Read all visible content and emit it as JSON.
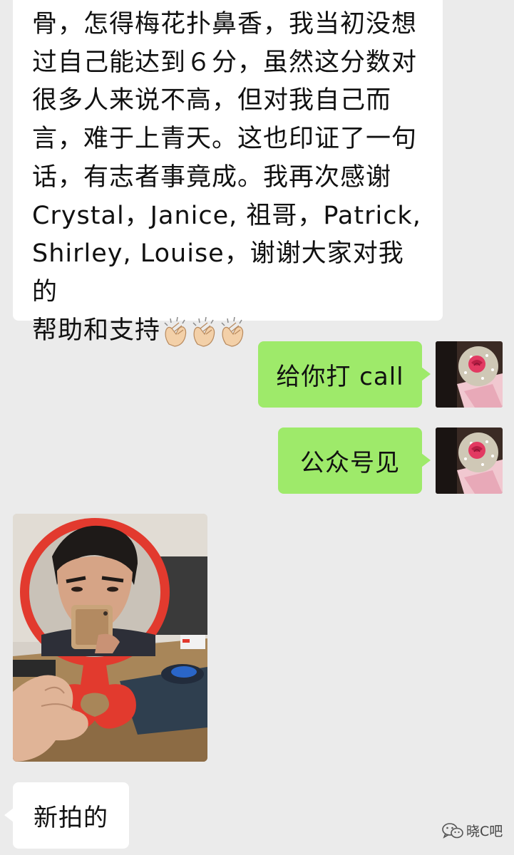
{
  "chat": {
    "messages": [
      {
        "side": "incoming",
        "type": "text",
        "lines": [
          "骨，怎得梅花扑鼻香，我当初没想",
          "过自己能达到６分，虽然这分数对",
          "很多人来说不高，但对我自己而",
          "言，难于上青天。这也印证了一句",
          "话，有志者事竟成。我再次感谢",
          "Crystal，Janice, 祖哥，Patrick,",
          "Shirley, Louise，谢谢大家对我的",
          "帮助和支持"
        ],
        "emoji": "clapping-hands-icon"
      },
      {
        "side": "outgoing",
        "type": "text",
        "text": "给你打 call",
        "avatar": "rose-bouquet-avatar"
      },
      {
        "side": "outgoing",
        "type": "text",
        "text": "公众号见",
        "avatar": "rose-bouquet-avatar"
      },
      {
        "side": "incoming",
        "type": "image",
        "image": "photo-man-red-mirror"
      },
      {
        "side": "incoming",
        "type": "text",
        "text": "新拍的"
      }
    ]
  },
  "watermark": {
    "text": "晓C吧",
    "icon": "wechat-icon"
  },
  "colors": {
    "background": "#ebebeb",
    "incoming_bubble": "#ffffff",
    "outgoing_bubble": "#9eea6a"
  }
}
